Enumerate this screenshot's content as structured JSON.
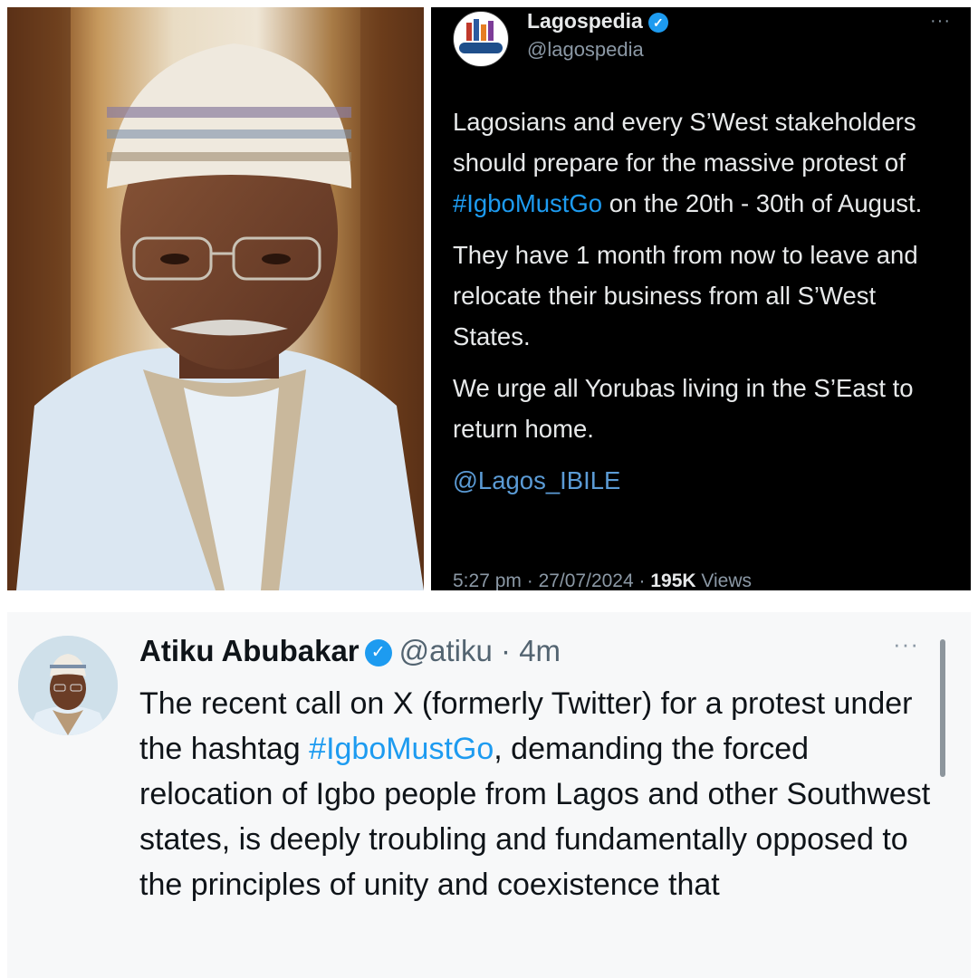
{
  "photo": {
    "alt_subject": "portrait-photo",
    "colors": {
      "skin": "#7a4a30",
      "robe": "#d9e6f2",
      "cap": "#efe9de"
    }
  },
  "lagospedia_tweet": {
    "avatar_text": "LAGOSPEDIA",
    "display_name": "Lagospedia",
    "handle": "@lagospedia",
    "more_label": "···",
    "paragraph1_before": "Lagosians and every S’West stakeholders should prepare for the massive protest of ",
    "hashtag": "#IgboMustGo",
    "paragraph1_after": " on the 20th - 30th of August.",
    "paragraph2": "They have 1 month from now to leave and relocate their business from all S’West States.",
    "paragraph3": "We urge all Yorubas living in the S’East to return home.",
    "mention": "@Lagos_IBILE",
    "time": "5:27 pm",
    "date": "27/07/2024",
    "view_count": "195K",
    "views_label": "Views",
    "separator": " · "
  },
  "atiku_tweet": {
    "display_name": "Atiku Abubakar",
    "handle": "@atiku",
    "age": "4m",
    "dot": " · ",
    "more_label": "···",
    "text_before": "The recent call on X (formerly Twitter) for a protest under the hashtag ",
    "hashtag": "#IgboMustGo",
    "text_after": ", demanding the forced relocation of Igbo people from Lagos and other Southwest states, is deeply troubling and fundamentally opposed to the principles of unity and coexistence that"
  },
  "colors": {
    "link_blue": "#1d9bf0",
    "verified_blue": "#1d9bf0",
    "dark_bg": "#000000",
    "light_bg": "#f7f8f9",
    "muted_text": "#8b98a5"
  }
}
